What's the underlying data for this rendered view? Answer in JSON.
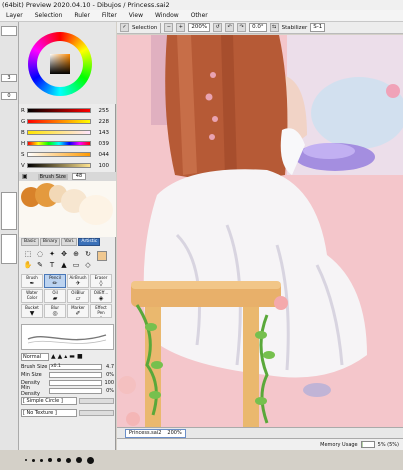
{
  "window": {
    "title": "(64bit) Preview 2020.04.10 - Dibujos / Princess.sai2"
  },
  "menu": [
    "Layer",
    "Selection",
    "Ruler",
    "Filter",
    "View",
    "Window",
    "Other"
  ],
  "toolbar": {
    "selection_label": "Selection",
    "zoom": "200%",
    "angle": "0.0°",
    "stabilizer_label": "Stabilizer",
    "stabilizer_value": "S-1"
  },
  "leftstrip": {
    "value_1": "3",
    "value_2": "0"
  },
  "color_sliders": [
    {
      "letter": "R",
      "value": "255",
      "colors": [
        "#000000",
        "#ff0000"
      ]
    },
    {
      "letter": "G",
      "value": "228",
      "colors": [
        "#ff0000",
        "#ffff00"
      ]
    },
    {
      "letter": "B",
      "value": "143",
      "colors": [
        "#ffe400",
        "#ffe4ff"
      ]
    },
    {
      "letter": "H",
      "value": "039",
      "colors": [
        "#ff0000",
        "#ffff00",
        "#00ff00",
        "#00ffff",
        "#0000ff",
        "#ff00ff",
        "#ff0000"
      ]
    },
    {
      "letter": "S",
      "value": "044",
      "colors": [
        "#ffffff",
        "#ff9a00"
      ]
    },
    {
      "letter": "V",
      "value": "100",
      "colors": [
        "#000000",
        "#ffe48f"
      ]
    }
  ],
  "brush": {
    "size_label": "Brush Size",
    "size_value": "48"
  },
  "tool_tabs": [
    "Basic",
    "Binary",
    "Vari.",
    "Artistic"
  ],
  "tools": [
    "selection-icon",
    "lasso-icon",
    "magic-wand-icon",
    "move-icon",
    "zoom-icon",
    "rotate-icon",
    "hand-icon",
    "eyedropper-icon",
    "text-icon",
    "fill-icon",
    "eraser-icon",
    "shape-icon"
  ],
  "tool_glyphs": [
    "⬚",
    "◌",
    "✦",
    "✥",
    "⊕",
    "↻",
    "✋",
    "✎",
    "T",
    "▲",
    "▭",
    "◇"
  ],
  "brushes": [
    {
      "label": "Brush",
      "glyph": "✒"
    },
    {
      "label": "Pencil",
      "glyph": "✏",
      "active": true
    },
    {
      "label": "AirBrush",
      "glyph": "✈"
    },
    {
      "label": "Eraser",
      "glyph": "◊"
    },
    {
      "label": "Water Color",
      "glyph": "≈"
    },
    {
      "label": "Oil",
      "glyph": "▰"
    },
    {
      "label": "OilBlur",
      "glyph": "▱"
    },
    {
      "label": "OilEff...",
      "glyph": "◈"
    },
    {
      "label": "Bucket",
      "glyph": "▼"
    },
    {
      "label": "Blur",
      "glyph": "◎"
    },
    {
      "label": "Marker",
      "glyph": "✐"
    },
    {
      "label": "Effect Pen",
      "glyph": "✧"
    }
  ],
  "blend_mode": "Normal",
  "params": [
    {
      "label": "Brush Size",
      "prefix": "x0.1",
      "value": "4.7",
      "fill": 0.1
    },
    {
      "label": "Min Size",
      "prefix": "",
      "value": "0%",
      "fill": 0.0
    },
    {
      "label": "Density",
      "prefix": "",
      "value": "100",
      "fill": 1.0
    },
    {
      "label": "Min Density",
      "prefix": "",
      "value": "0%",
      "fill": 0.0
    }
  ],
  "textures": [
    "[ Simple Circle ]",
    "[ No Texture ]"
  ],
  "document_tab": {
    "name": "Princess.sai2",
    "zoom": "200%"
  },
  "status": {
    "memory_label": "Memory Usage",
    "memory_value": "5% (5%)"
  }
}
